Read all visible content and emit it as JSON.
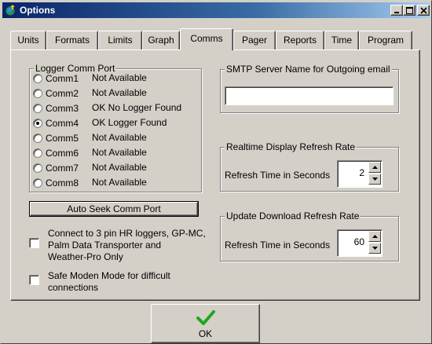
{
  "window": {
    "title": "Options"
  },
  "tabs": [
    "Units",
    "Formats",
    "Limits",
    "Graph",
    "Comms",
    "Pager",
    "Reports",
    "Time",
    "Program"
  ],
  "active_tab": "Comms",
  "logger_port": {
    "title": "Logger Comm Port",
    "ports": [
      {
        "label": "Comm1",
        "status": "Not Available",
        "selected": false
      },
      {
        "label": "Comm2",
        "status": "Not Available",
        "selected": false
      },
      {
        "label": "Comm3",
        "status": "OK No Logger Found",
        "selected": false
      },
      {
        "label": "Comm4",
        "status": "OK Logger Found",
        "selected": true
      },
      {
        "label": "Comm5",
        "status": "Not Available",
        "selected": false
      },
      {
        "label": "Comm6",
        "status": "Not Available",
        "selected": false
      },
      {
        "label": "Comm7",
        "status": "Not Available",
        "selected": false
      },
      {
        "label": "Comm8",
        "status": "Not Available",
        "selected": false
      }
    ]
  },
  "auto_seek": {
    "label": "Auto Seek Comm Port"
  },
  "connect_3pin": {
    "lines": [
      "Connect to 3 pin HR loggers, GP-MC,",
      "Palm Data Transporter and",
      "Weather-Pro Only"
    ],
    "checked": false
  },
  "safe_modem": {
    "lines": [
      "Safe Moden Mode for difficult",
      "connections"
    ],
    "checked": false
  },
  "smtp": {
    "title": "SMTP Server Name for Outgoing email",
    "value": ""
  },
  "realtime": {
    "title": "Realtime Display  Refresh Rate",
    "label": "Refresh Time in Seconds",
    "value": "2"
  },
  "update_download": {
    "title": "Update Download  Refresh Rate",
    "label": "Refresh Time in Seconds",
    "value": "60"
  },
  "ok_button": {
    "label": "OK"
  },
  "colors": {
    "face": "#d4d0c8",
    "title_start": "#0a246a",
    "title_end": "#a6caf0",
    "check_green": "#1fa51f"
  }
}
